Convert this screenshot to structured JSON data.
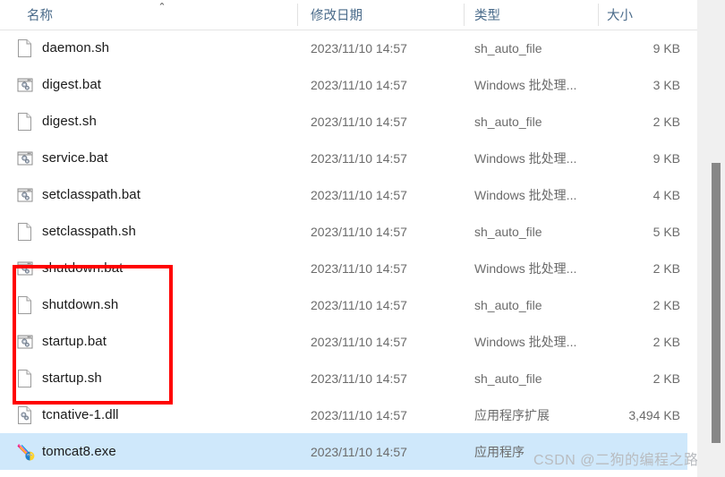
{
  "window": {
    "app": "Windows File Explorer",
    "view": "details"
  },
  "header": {
    "columns": [
      {
        "label": "名称",
        "name": "column-header-name"
      },
      {
        "label": "修改日期",
        "name": "column-header-date-modified"
      },
      {
        "label": "类型",
        "name": "column-header-type"
      },
      {
        "label": "大小",
        "name": "column-header-size"
      }
    ],
    "sort_indicator": "⌃",
    "sort_column": "名称",
    "sort_direction": "ascending"
  },
  "files": [
    {
      "name": "daemon.sh",
      "date": "2023/11/10 14:57",
      "type": "sh_auto_file",
      "size": "9 KB",
      "icon": "plain-file-icon",
      "selected": false
    },
    {
      "name": "digest.bat",
      "date": "2023/11/10 14:57",
      "type": "Windows 批处理...",
      "size": "3 KB",
      "icon": "batch-file-icon",
      "selected": false
    },
    {
      "name": "digest.sh",
      "date": "2023/11/10 14:57",
      "type": "sh_auto_file",
      "size": "2 KB",
      "icon": "plain-file-icon",
      "selected": false
    },
    {
      "name": "service.bat",
      "date": "2023/11/10 14:57",
      "type": "Windows 批处理...",
      "size": "9 KB",
      "icon": "batch-file-icon",
      "selected": false
    },
    {
      "name": "setclasspath.bat",
      "date": "2023/11/10 14:57",
      "type": "Windows 批处理...",
      "size": "4 KB",
      "icon": "batch-file-icon",
      "selected": false
    },
    {
      "name": "setclasspath.sh",
      "date": "2023/11/10 14:57",
      "type": "sh_auto_file",
      "size": "5 KB",
      "icon": "plain-file-icon",
      "selected": false
    },
    {
      "name": "shutdown.bat",
      "date": "2023/11/10 14:57",
      "type": "Windows 批处理...",
      "size": "2 KB",
      "icon": "batch-file-icon",
      "selected": false
    },
    {
      "name": "shutdown.sh",
      "date": "2023/11/10 14:57",
      "type": "sh_auto_file",
      "size": "2 KB",
      "icon": "plain-file-icon",
      "selected": false
    },
    {
      "name": "startup.bat",
      "date": "2023/11/10 14:57",
      "type": "Windows 批处理...",
      "size": "2 KB",
      "icon": "batch-file-icon",
      "selected": false
    },
    {
      "name": "startup.sh",
      "date": "2023/11/10 14:57",
      "type": "sh_auto_file",
      "size": "2 KB",
      "icon": "plain-file-icon",
      "selected": false
    },
    {
      "name": "tcnative-1.dll",
      "date": "2023/11/10 14:57",
      "type": "应用程序扩展",
      "size": "3,494 KB",
      "icon": "dll-file-icon",
      "selected": false
    },
    {
      "name": "tomcat8.exe",
      "date": "2023/11/10 14:57",
      "type": "应用程序",
      "size": "",
      "icon": "tomcat-app-icon",
      "selected": true
    }
  ],
  "annotation": {
    "box_color": "#ff0000",
    "highlights": [
      "shutdown.bat",
      "shutdown.sh",
      "startup.bat",
      "startup.sh"
    ]
  },
  "watermark": {
    "text": "CSDN @二狗的编程之路"
  },
  "colors": {
    "header_text": "#4a6b8a",
    "file_name_text": "#1a1a1a",
    "meta_text": "#6b6b6b",
    "selection": "#cfe8fb",
    "annotation_red": "#ff0000",
    "scrollbar_thumb": "#878787",
    "scrollbar_track": "#f0f0f0"
  },
  "scrollbar": {
    "orientation": "vertical",
    "thumb_top_pct": 34,
    "thumb_height_pct": 59
  }
}
